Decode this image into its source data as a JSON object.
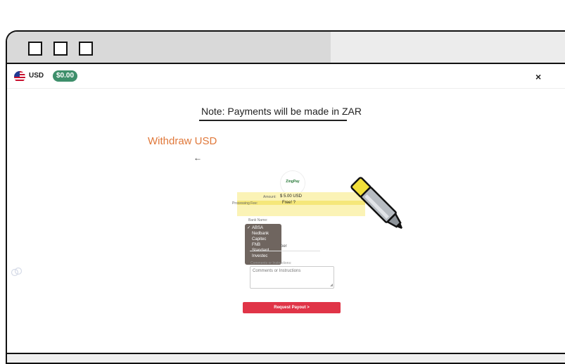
{
  "topbar": {
    "currency": "USD",
    "balance": "$0.00",
    "close": "×"
  },
  "note": "Note: Payments will be made in ZAR",
  "withdraw_title": "Withdraw USD",
  "back": "←",
  "logo_text": "ZingPay",
  "summary": {
    "amount_label": "Amount:",
    "amount_value": "$ 5.00 USD",
    "fee_label": "Processing Fee:",
    "fee_value": "Free! ?"
  },
  "bank": {
    "label": "Bank Name:",
    "check": "✓",
    "options": [
      "ABSA",
      "Nedbank",
      "Capitec",
      "FNB",
      "Standard",
      "Investec"
    ]
  },
  "account_number_partial": "ber",
  "comments": {
    "label": "Comments or Instructions:",
    "placeholder": "Comments or Instructions"
  },
  "payout_button": "Request Payout  >",
  "colors": {
    "accent_orange": "#e0783a",
    "balance_green": "#3e8f6b",
    "payout_red": "#e03447",
    "highlight_yellow": "#f5e77a"
  },
  "icons": [
    "window-square-icon",
    "us-flag-icon",
    "close-icon",
    "back-arrow-icon",
    "highlighter-marker-icon",
    "side-link-icon"
  ]
}
